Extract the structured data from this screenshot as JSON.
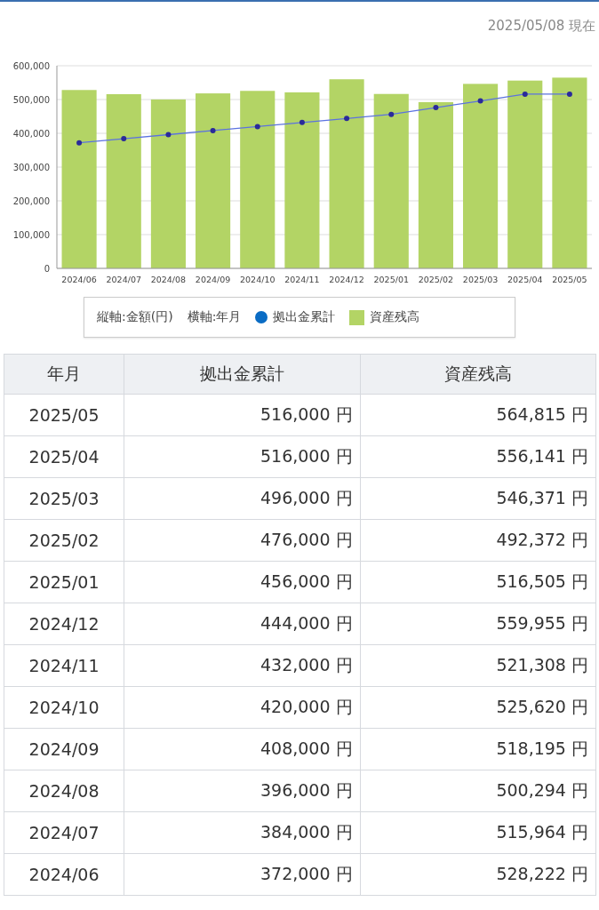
{
  "as_of": "2025/05/08 現在",
  "chart": {
    "chart_data": {
      "type": "bar",
      "categories": [
        "2024/06",
        "2024/07",
        "2024/08",
        "2024/09",
        "2024/10",
        "2024/11",
        "2024/12",
        "2025/01",
        "2025/02",
        "2025/03",
        "2025/04",
        "2025/05"
      ],
      "series": [
        {
          "name": "資産残高",
          "type": "bar",
          "color": "#b3d465",
          "values": [
            528222,
            515964,
            500294,
            518195,
            525620,
            521308,
            559955,
            516505,
            492372,
            546371,
            556141,
            564815
          ]
        },
        {
          "name": "拠出金累計",
          "type": "line",
          "color": "#5b72e0",
          "marker": "circle",
          "values": [
            372000,
            384000,
            396000,
            408000,
            420000,
            432000,
            444000,
            456000,
            476000,
            496000,
            516000,
            516000
          ]
        }
      ],
      "stacked": false,
      "grid": true,
      "ylim": [
        0,
        600000
      ],
      "yticks": [
        {
          "value": 0,
          "label": "0"
        },
        {
          "value": 100000,
          "label": "100,000"
        },
        {
          "value": 200000,
          "label": "200,000"
        },
        {
          "value": 300000,
          "label": "300,000"
        },
        {
          "value": 400000,
          "label": "400,000"
        },
        {
          "value": 500000,
          "label": "500,000"
        },
        {
          "value": 600000,
          "label": "600,000"
        }
      ]
    },
    "legend": {
      "items": [
        {
          "kind": "text",
          "label": "縦軸:金額(円)"
        },
        {
          "kind": "text",
          "label": "横軸:年月"
        },
        {
          "kind": "dot",
          "color": "#0a6cc4"
        },
        {
          "kind": "square",
          "color": "#b3d465"
        }
      ]
    }
  },
  "table": {
    "columns": [
      "年月",
      "拠出金累計",
      "資産残高"
    ],
    "rows": [
      [
        "2025/05",
        "516,000 円",
        "564,815 円"
      ],
      [
        "2025/04",
        "516,000 円",
        "556,141 円"
      ],
      [
        "2025/03",
        "496,000 円",
        "546,371 円"
      ],
      [
        "2025/02",
        "476,000 円",
        "492,372 円"
      ],
      [
        "2025/01",
        "456,000 円",
        "516,505 円"
      ],
      [
        "2024/12",
        "444,000 円",
        "559,955 円"
      ],
      [
        "2024/11",
        "432,000 円",
        "521,308 円"
      ],
      [
        "2024/10",
        "420,000 円",
        "525,620 円"
      ],
      [
        "2024/09",
        "408,000 円",
        "518,195 円"
      ],
      [
        "2024/08",
        "396,000 円",
        "500,294 円"
      ],
      [
        "2024/07",
        "384,000 円",
        "515,964 円"
      ],
      [
        "2024/06",
        "372,000 円",
        "528,222 円"
      ]
    ]
  }
}
